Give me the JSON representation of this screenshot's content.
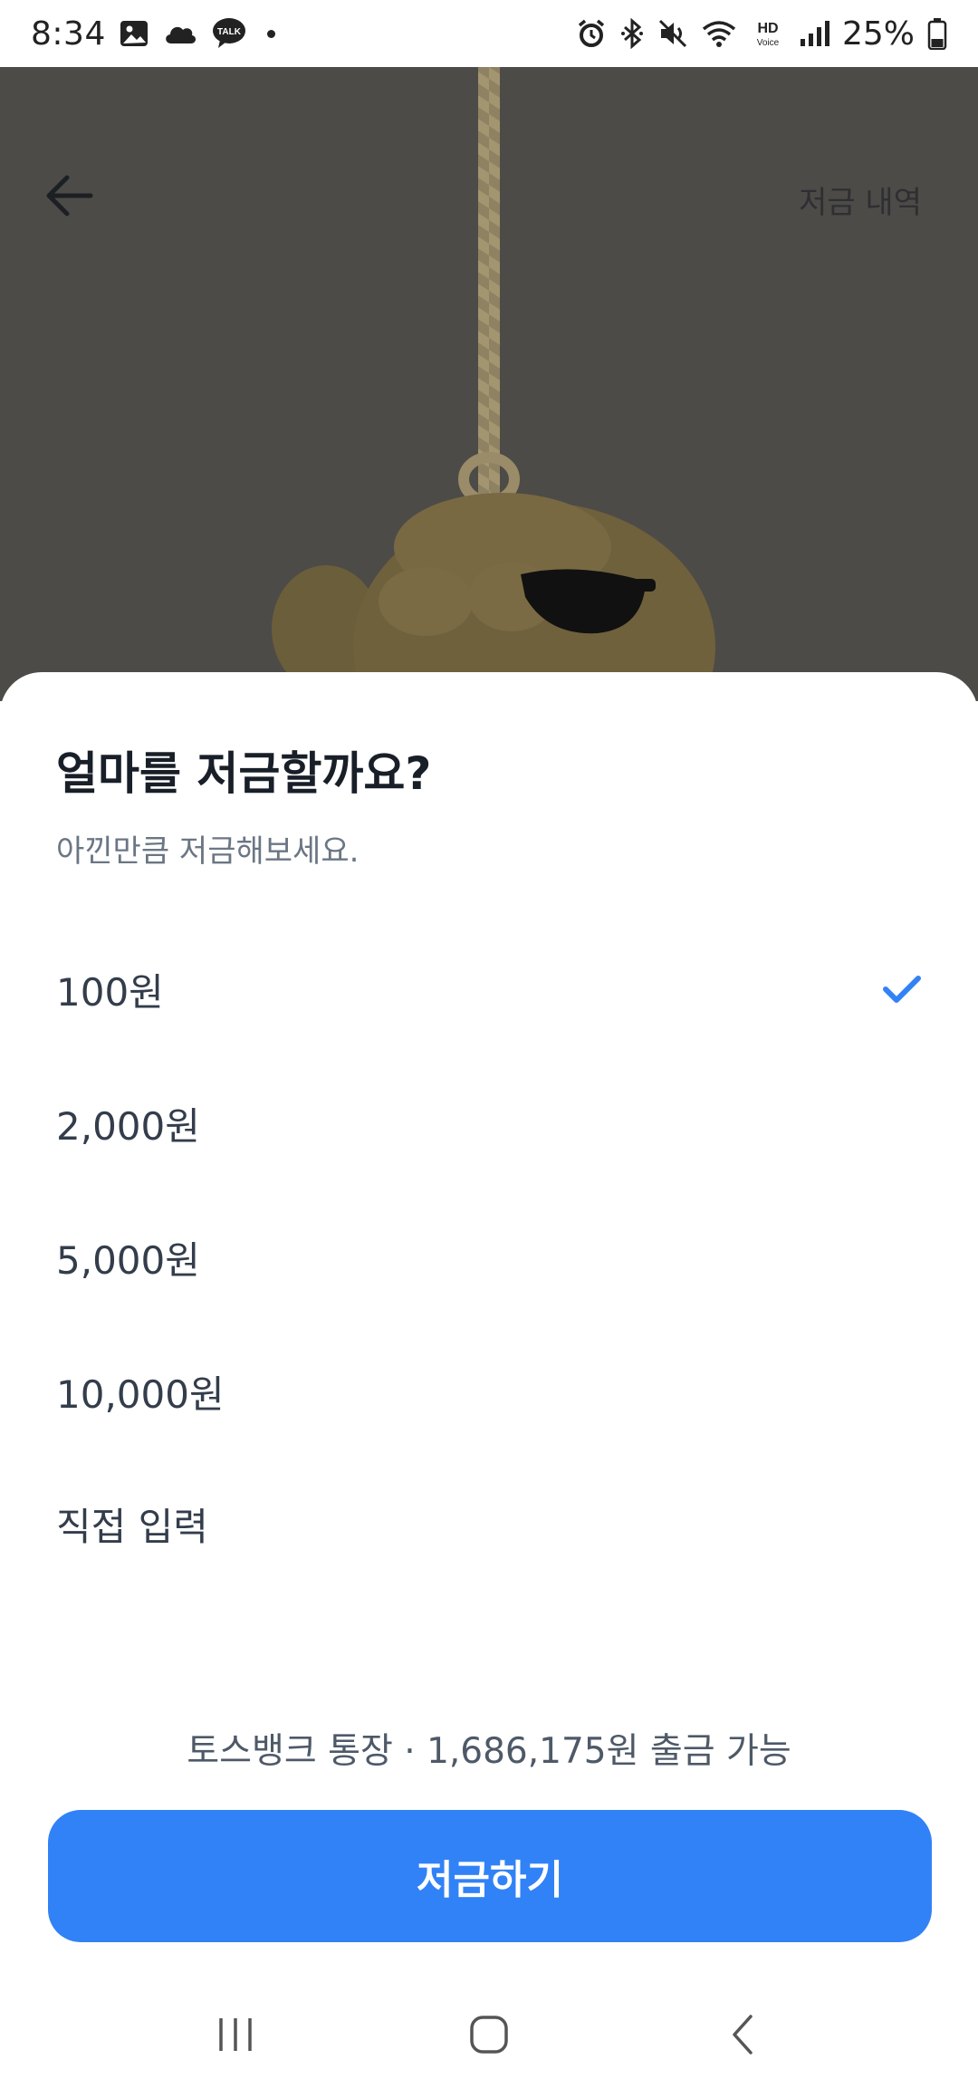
{
  "status_bar": {
    "time": "8:34",
    "battery_percent": "25%",
    "notification_icons": [
      "gallery-icon",
      "cloud-icon",
      "kakaotalk-icon",
      "more-dot-icon"
    ],
    "system_icons": [
      "alarm-icon",
      "bluetooth-icon",
      "mute-icon",
      "wifi-icon",
      "hd-voice-icon",
      "signal-icon",
      "battery-icon"
    ],
    "hd_voice_top": "HD",
    "hd_voice_bottom": "Voice",
    "talk_badge": "TALK"
  },
  "header": {
    "back_icon": "arrow-left-icon",
    "history_label": "저금 내역"
  },
  "sheet": {
    "title": "얼마를 저금할까요?",
    "subtitle": "아낀만큼 저금해보세요.",
    "options": [
      {
        "label": "100원",
        "selected": true
      },
      {
        "label": "2,000원",
        "selected": false
      },
      {
        "label": "5,000원",
        "selected": false
      },
      {
        "label": "10,000원",
        "selected": false
      },
      {
        "label": "직접 입력",
        "selected": false
      }
    ],
    "balance_info": "토스뱅크 통장 · 1,686,175원 출금 가능",
    "submit_label": "저금하기"
  },
  "colors": {
    "accent": "#3182f6",
    "hero_dim": "#4d4b47",
    "title": "#191f28",
    "subtitle": "#6b7684"
  },
  "nav_bar": {
    "icons": [
      "recent-apps-icon",
      "home-icon",
      "back-icon"
    ]
  }
}
